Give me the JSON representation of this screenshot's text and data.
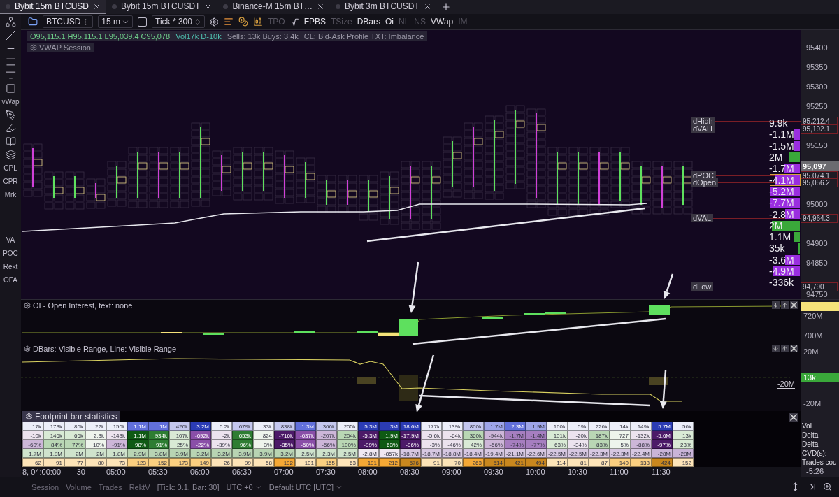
{
  "tabs": [
    {
      "label": "Bybit 15m BTCUSD",
      "selected": true
    },
    {
      "label": "Bybit 15m BTCUSDT",
      "selected": false
    },
    {
      "label": "Binance-M 15m BT…",
      "selected": false
    },
    {
      "label": "Bybit 3m BTCUSDT",
      "selected": false
    }
  ],
  "sidebar": {
    "labels": [
      "vWap",
      "CPL",
      "CPR",
      "Mrk",
      "VA",
      "POC",
      "Rekt",
      "OFA"
    ]
  },
  "toolbar": {
    "symbol": "BTCUSD",
    "interval": "15 m",
    "tick_checkbox": {
      "checked": false
    },
    "tick": "Tick * 300",
    "buttons": [
      {
        "label": "TPO",
        "on": false
      },
      {
        "label": "FPBS",
        "on": true
      },
      {
        "label": "TSize",
        "on": false
      },
      {
        "label": "DBars",
        "on": true
      },
      {
        "label": "Oi",
        "on": true
      },
      {
        "label": "NL",
        "on": false
      },
      {
        "label": "NS",
        "on": false
      },
      {
        "label": "VWap",
        "on": true
      },
      {
        "label": "IM",
        "on": false
      }
    ]
  },
  "legend": {
    "ohlc": "O95,115.1 H95,115.1 L95,039.4 C95,078",
    "volume": "Vol17k D-10k",
    "flow": "Sells: 13k Buys: 3.4k",
    "settings": "CL: Bid-Ask Profile TXT: Imbalance",
    "study": "VWAP Session"
  },
  "price_axis": {
    "ticks": [
      "95400",
      "95350",
      "95300",
      "95250",
      "95150",
      "95000",
      "94900",
      "94850",
      "94750"
    ],
    "last_price": "95,097"
  },
  "levels": [
    {
      "label": "dHigh",
      "price": "95,212.4"
    },
    {
      "label": "dVAH",
      "price": "95,192.1"
    },
    {
      "label": "dPOC",
      "price": "95,074.1"
    },
    {
      "label": "dOpen",
      "price": "95,056.2"
    },
    {
      "label": "dVAL",
      "price": "94,964.3"
    },
    {
      "label": "dLow",
      "price": "94,790"
    }
  ],
  "profile": [
    {
      "text": "9.9k",
      "kind": "sell",
      "level": 0,
      "outlined": false
    },
    {
      "text": "-1.1M",
      "kind": "sell",
      "level": 0.2,
      "outlined": false
    },
    {
      "text": "-1.5M",
      "kind": "sell",
      "level": 0.2,
      "outlined": false
    },
    {
      "text": "2M",
      "kind": "buy",
      "level": 0.35,
      "outlined": false
    },
    {
      "text": "-1.7M",
      "kind": "sell",
      "level": 0.55,
      "outlined": false
    },
    {
      "text": "-4.1M",
      "kind": "sell",
      "level": 0.85,
      "outlined": true
    },
    {
      "text": "-5.2M",
      "kind": "sell",
      "level": 1,
      "outlined": false
    },
    {
      "text": "-7.7M",
      "kind": "sell",
      "level": 1,
      "outlined": false
    },
    {
      "text": "-2.8M",
      "kind": "sell",
      "level": 0.5,
      "outlined": false
    },
    {
      "text": "2M",
      "kind": "buy",
      "level": 0.95,
      "outlined": false
    },
    {
      "text": "1.1M",
      "kind": "buy",
      "level": 0.2,
      "outlined": false
    },
    {
      "text": "35k",
      "kind": "buy",
      "level": 0.05,
      "outlined": false
    },
    {
      "text": "-3.6M",
      "kind": "sell",
      "level": 0.5,
      "outlined": false
    },
    {
      "text": "-4.9M",
      "kind": "sell",
      "level": 0.9,
      "outlined": false
    },
    {
      "text": "-336k",
      "kind": "sell",
      "level": 0,
      "outlined": false
    }
  ],
  "oi_panel": {
    "title": "OI - Open Interest, text: none",
    "axis": [
      {
        "text": "720M",
        "kind": "tick"
      },
      {
        "text": "700M",
        "kind": "tick"
      }
    ]
  },
  "dbars_panel": {
    "title": "DBars: Visible Range, Line: Visible Range",
    "axis": [
      {
        "text": "20M",
        "kind": "tick"
      },
      {
        "text": "13k",
        "kind": "marker"
      },
      {
        "text": "-20M",
        "kind": "tick"
      }
    ],
    "line_label": "-20M"
  },
  "stats": {
    "title": "Footprint bar statistics",
    "rows": [
      {
        "label": "Vol",
        "cells": [
          {
            "text": "17k",
            "color": "#eceef9"
          },
          {
            "text": "173k",
            "color": "#eceef9"
          },
          {
            "text": "86k",
            "color": "#eceef9"
          },
          {
            "text": "22k",
            "color": "#eceef9"
          },
          {
            "text": "156k",
            "color": "#eceef9"
          },
          {
            "text": "1.1M",
            "color": "#6270db"
          },
          {
            "text": "1M",
            "color": "#6270db"
          },
          {
            "text": "426k",
            "color": "#c4c7ee"
          },
          {
            "text": "3.2M",
            "color": "#2b3cb4"
          },
          {
            "text": "5.2k",
            "color": "#eceef9"
          },
          {
            "text": "679k",
            "color": "#c4c7ee"
          },
          {
            "text": "33k",
            "color": "#eceef9"
          },
          {
            "text": "838k",
            "color": "#c4c7ee"
          },
          {
            "text": "1.3M",
            "color": "#6270db"
          },
          {
            "text": "366k",
            "color": "#c4c7ee"
          },
          {
            "text": "205k",
            "color": "#eceef9"
          },
          {
            "text": "5.3M",
            "color": "#2b3cb4"
          },
          {
            "text": "3M",
            "color": "#2b3cb4"
          },
          {
            "text": "18.6M",
            "color": "#2b3cb4"
          },
          {
            "text": "177k",
            "color": "#eceef9"
          },
          {
            "text": "139k",
            "color": "#eceef9"
          },
          {
            "text": "860k",
            "color": "#c4c7ee"
          },
          {
            "text": "1.7M",
            "color": "#9ea5e8"
          },
          {
            "text": "2.3M",
            "color": "#6270db"
          },
          {
            "text": "1.9M",
            "color": "#9ea5e8"
          },
          {
            "text": "160k",
            "color": "#eceef9"
          },
          {
            "text": "59k",
            "color": "#eceef9"
          },
          {
            "text": "226k",
            "color": "#eceef9"
          },
          {
            "text": "14k",
            "color": "#eceef9"
          },
          {
            "text": "149k",
            "color": "#eceef9"
          },
          {
            "text": "5.7M",
            "color": "#2b3cb4"
          },
          {
            "text": "56k",
            "color": "#eceef9"
          }
        ]
      },
      {
        "label": "Delta",
        "cells": [
          {
            "text": "-10k",
            "color": "#ece3ee"
          },
          {
            "text": "146k",
            "color": "#d9ead5"
          },
          {
            "text": "66k",
            "color": "#d9ead5"
          },
          {
            "text": "2.3k",
            "color": "#eef4ec"
          },
          {
            "text": "-143k",
            "color": "#ece3ee"
          },
          {
            "text": "1.1M",
            "color": "#0f5a14"
          },
          {
            "text": "934k",
            "color": "#2e7d32"
          },
          {
            "text": "107k",
            "color": "#d9ead5"
          },
          {
            "text": "-692k",
            "color": "#8a4fa8"
          },
          {
            "text": "-2k",
            "color": "#ece3ee"
          },
          {
            "text": "653k",
            "color": "#2e7d32"
          },
          {
            "text": "824",
            "color": "#eef4ec"
          },
          {
            "text": "-716k",
            "color": "#4c1a68"
          },
          {
            "text": "-637k",
            "color": "#8a4fa8"
          },
          {
            "text": "-207k",
            "color": "#cdb6d8"
          },
          {
            "text": "204k",
            "color": "#b9d7b4"
          },
          {
            "text": "-5.3M",
            "color": "#4c1a68"
          },
          {
            "text": "1.9M",
            "color": "#0f5a14"
          },
          {
            "text": "-17.9M",
            "color": "#4c1a68"
          },
          {
            "text": "-5.6k",
            "color": "#ece3ee"
          },
          {
            "text": "-64k",
            "color": "#ece3ee"
          },
          {
            "text": "360k",
            "color": "#b9d7b4"
          },
          {
            "text": "-944k",
            "color": "#cdb6d8"
          },
          {
            "text": "-1.7M",
            "color": "#a67ec0"
          },
          {
            "text": "-1.4M",
            "color": "#a67ec0"
          },
          {
            "text": "101k",
            "color": "#d9ead5"
          },
          {
            "text": "-20k",
            "color": "#ece3ee"
          },
          {
            "text": "187k",
            "color": "#b9d7b4"
          },
          {
            "text": "727",
            "color": "#eef4ec"
          },
          {
            "text": "-132k",
            "color": "#ece3ee"
          },
          {
            "text": "-5.6M",
            "color": "#4c1a68"
          },
          {
            "text": "13k",
            "color": "#d9ead5"
          }
        ]
      },
      {
        "label": "Delta",
        "cells": [
          {
            "text": "-60%",
            "color": "#cdb6d8"
          },
          {
            "text": "84%",
            "color": "#b9d7b4"
          },
          {
            "text": "77%",
            "color": "#b9d7b4"
          },
          {
            "text": "10%",
            "color": "#eef4ec"
          },
          {
            "text": "-91%",
            "color": "#cdb6d8"
          },
          {
            "text": "98%",
            "color": "#0f5a14"
          },
          {
            "text": "91%",
            "color": "#2e7d32"
          },
          {
            "text": "25%",
            "color": "#d9ead5"
          },
          {
            "text": "-22%",
            "color": "#8a4fa8"
          },
          {
            "text": "-39%",
            "color": "#ece3ee"
          },
          {
            "text": "96%",
            "color": "#2e7d32"
          },
          {
            "text": "3%",
            "color": "#eef4ec"
          },
          {
            "text": "-85%",
            "color": "#4c1a68"
          },
          {
            "text": "-50%",
            "color": "#8a4fa8"
          },
          {
            "text": "-56%",
            "color": "#cdb6d8"
          },
          {
            "text": "100%",
            "color": "#b9d7b4"
          },
          {
            "text": "-99%",
            "color": "#4c1a68"
          },
          {
            "text": "63%",
            "color": "#0f5a14"
          },
          {
            "text": "-96%",
            "color": "#4c1a68"
          },
          {
            "text": "-3%",
            "color": "#ece3ee"
          },
          {
            "text": "-46%",
            "color": "#ece3ee"
          },
          {
            "text": "42%",
            "color": "#d9ead5"
          },
          {
            "text": "-56%",
            "color": "#cdb6d8"
          },
          {
            "text": "-74%",
            "color": "#a67ec0"
          },
          {
            "text": "-77%",
            "color": "#a67ec0"
          },
          {
            "text": "63%",
            "color": "#d9ead5"
          },
          {
            "text": "-34%",
            "color": "#ece3ee"
          },
          {
            "text": "83%",
            "color": "#b9d7b4"
          },
          {
            "text": "5%",
            "color": "#eef4ec"
          },
          {
            "text": "-88%",
            "color": "#cdb6d8"
          },
          {
            "text": "-97%",
            "color": "#4c1a68"
          },
          {
            "text": "23%",
            "color": "#d9ead5"
          }
        ]
      },
      {
        "label": "CVD(s):",
        "cells": [
          {
            "text": "1.7M",
            "color": "#cfe3cc"
          },
          {
            "text": "1.9M",
            "color": "#cfe3cc"
          },
          {
            "text": "2M",
            "color": "#cfe3cc"
          },
          {
            "text": "2M",
            "color": "#cfe3cc"
          },
          {
            "text": "1.8M",
            "color": "#cfe3cc"
          },
          {
            "text": "2.9M",
            "color": "#b8d4b3"
          },
          {
            "text": "3.8M",
            "color": "#b8d4b3"
          },
          {
            "text": "3.9M",
            "color": "#b8d4b3"
          },
          {
            "text": "3.2M",
            "color": "#b8d4b3"
          },
          {
            "text": "3.2M",
            "color": "#b8d4b3"
          },
          {
            "text": "3.9M",
            "color": "#b8d4b3"
          },
          {
            "text": "3.9M",
            "color": "#b8d4b3"
          },
          {
            "text": "3.2M",
            "color": "#b8d4b3"
          },
          {
            "text": "2.5M",
            "color": "#cfe3cc"
          },
          {
            "text": "2.3M",
            "color": "#cfe3cc"
          },
          {
            "text": "2.5M",
            "color": "#cfe3cc"
          },
          {
            "text": "-2.8M",
            "color": "#f0e8f2"
          },
          {
            "text": "-857k",
            "color": "#f0e8f2"
          },
          {
            "text": "-18.7M",
            "color": "#d7c8e2"
          },
          {
            "text": "-18.7M",
            "color": "#d7c8e2"
          },
          {
            "text": "-18.8M",
            "color": "#d7c8e2"
          },
          {
            "text": "-18.4M",
            "color": "#d7c8e2"
          },
          {
            "text": "-19.4M",
            "color": "#d7c8e2"
          },
          {
            "text": "-21.1M",
            "color": "#d7c8e2"
          },
          {
            "text": "-22.6M",
            "color": "#d7c8e2"
          },
          {
            "text": "-22.5M",
            "color": "#d7c8e2"
          },
          {
            "text": "-22.5M",
            "color": "#d7c8e2"
          },
          {
            "text": "-22.3M",
            "color": "#d7c8e2"
          },
          {
            "text": "-22.3M",
            "color": "#d7c8e2"
          },
          {
            "text": "-22.4M",
            "color": "#d7c8e2"
          },
          {
            "text": "-28M",
            "color": "#c9b4d8"
          },
          {
            "text": "-28M",
            "color": "#c9b4d8"
          }
        ]
      },
      {
        "label": "Trades cou",
        "cells": [
          {
            "text": "62",
            "color": "#fde4b8"
          },
          {
            "text": "91",
            "color": "#fde4b8"
          },
          {
            "text": "77",
            "color": "#fde4b8"
          },
          {
            "text": "80",
            "color": "#fde4b8"
          },
          {
            "text": "73",
            "color": "#fde4b8"
          },
          {
            "text": "123",
            "color": "#fbcf80"
          },
          {
            "text": "152",
            "color": "#fbcf80"
          },
          {
            "text": "173",
            "color": "#fbcf80"
          },
          {
            "text": "149",
            "color": "#fbcf80"
          },
          {
            "text": "26",
            "color": "#fde4b8"
          },
          {
            "text": "99",
            "color": "#fde4b8"
          },
          {
            "text": "58",
            "color": "#fde4b8"
          },
          {
            "text": "192",
            "color": "#f5a835"
          },
          {
            "text": "101",
            "color": "#fde4b8"
          },
          {
            "text": "155",
            "color": "#fbcf80"
          },
          {
            "text": "63",
            "color": "#fde4b8"
          },
          {
            "text": "191",
            "color": "#f5a835"
          },
          {
            "text": "212",
            "color": "#f5a835"
          },
          {
            "text": "576",
            "color": "#c9871e"
          },
          {
            "text": "91",
            "color": "#fde4b8"
          },
          {
            "text": "70",
            "color": "#fde4b8"
          },
          {
            "text": "263",
            "color": "#f5a835"
          },
          {
            "text": "514",
            "color": "#c9871e"
          },
          {
            "text": "421",
            "color": "#c9871e"
          },
          {
            "text": "494",
            "color": "#c9871e"
          },
          {
            "text": "114",
            "color": "#fde4b8"
          },
          {
            "text": "81",
            "color": "#fde4b8"
          },
          {
            "text": "87",
            "color": "#fde4b8"
          },
          {
            "text": "140",
            "color": "#fbcf80"
          },
          {
            "text": "138",
            "color": "#fbcf80"
          },
          {
            "text": "424",
            "color": "#c9871e"
          },
          {
            "text": "152",
            "color": "#fde4b8"
          }
        ]
      }
    ]
  },
  "time_axis": {
    "start": "8, 04:00:00",
    "labels": [
      "30",
      "05:00",
      "05:30",
      "06:00",
      "06:30",
      "07:00",
      "07:30",
      "08:00",
      "08:30",
      "09:00",
      "09:30",
      "10:00",
      "10:30",
      "11:00",
      "11:30"
    ],
    "countdown": "-5:26"
  },
  "status_bar": {
    "items": [
      "Session",
      "Volume",
      "Trades",
      "RektV"
    ],
    "info": "[Tick: 0.1, Bar: 30]",
    "timezone": "UTC +0",
    "zone_name": "Default UTC [UTC]"
  }
}
